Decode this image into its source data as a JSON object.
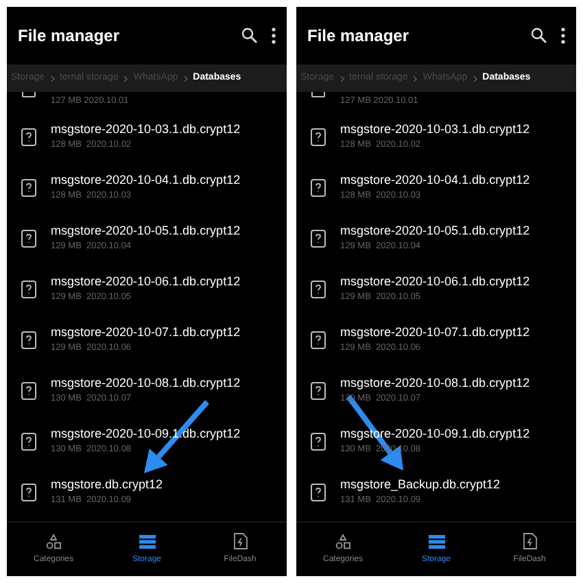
{
  "panels": [
    {
      "title": "File manager",
      "breadcrumbs": [
        {
          "label": "Storage",
          "selected": false
        },
        {
          "label": "ternal storage",
          "selected": false
        },
        {
          "label": "WhatsApp",
          "selected": false
        },
        {
          "label": "Databases",
          "selected": true
        }
      ],
      "partial_row": {
        "size": "127 MB",
        "date": "2020.10.01"
      },
      "files": [
        {
          "name": "msgstore-2020-10-03.1.db.crypt12",
          "size": "128 MB",
          "date": "2020.10.02"
        },
        {
          "name": "msgstore-2020-10-04.1.db.crypt12",
          "size": "128 MB",
          "date": "2020.10.03"
        },
        {
          "name": "msgstore-2020-10-05.1.db.crypt12",
          "size": "129 MB",
          "date": "2020.10.04"
        },
        {
          "name": "msgstore-2020-10-06.1.db.crypt12",
          "size": "129 MB",
          "date": "2020.10.05"
        },
        {
          "name": "msgstore-2020-10-07.1.db.crypt12",
          "size": "129 MB",
          "date": "2020.10.06"
        },
        {
          "name": "msgstore-2020-10-08.1.db.crypt12",
          "size": "130 MB",
          "date": "2020.10.07"
        },
        {
          "name": "msgstore-2020-10-09.1.db.crypt12",
          "size": "130 MB",
          "date": "2020.10.08"
        },
        {
          "name": "msgstore.db.crypt12",
          "size": "131 MB",
          "date": "2020.10.09"
        }
      ],
      "nav": [
        {
          "label": "Categories",
          "selected": false
        },
        {
          "label": "Storage",
          "selected": true
        },
        {
          "label": "FileDash",
          "selected": false
        }
      ]
    },
    {
      "title": "File manager",
      "breadcrumbs": [
        {
          "label": "Storage",
          "selected": false
        },
        {
          "label": "ternal storage",
          "selected": false
        },
        {
          "label": "WhatsApp",
          "selected": false
        },
        {
          "label": "Databases",
          "selected": true
        }
      ],
      "partial_row": {
        "size": "127 MB",
        "date": "2020.10.01"
      },
      "files": [
        {
          "name": "msgstore-2020-10-03.1.db.crypt12",
          "size": "128 MB",
          "date": "2020.10.02"
        },
        {
          "name": "msgstore-2020-10-04.1.db.crypt12",
          "size": "128 MB",
          "date": "2020.10.03"
        },
        {
          "name": "msgstore-2020-10-05.1.db.crypt12",
          "size": "129 MB",
          "date": "2020.10.04"
        },
        {
          "name": "msgstore-2020-10-06.1.db.crypt12",
          "size": "129 MB",
          "date": "2020.10.05"
        },
        {
          "name": "msgstore-2020-10-07.1.db.crypt12",
          "size": "129 MB",
          "date": "2020.10.06"
        },
        {
          "name": "msgstore-2020-10-08.1.db.crypt12",
          "size": "130 MB",
          "date": "2020.10.07"
        },
        {
          "name": "msgstore-2020-10-09.1.db.crypt12",
          "size": "130 MB",
          "date": "2020.10.08"
        },
        {
          "name": "msgstore_Backup.db.crypt12",
          "size": "131 MB",
          "date": "2020.10.09"
        }
      ],
      "nav": [
        {
          "label": "Categories",
          "selected": false
        },
        {
          "label": "Storage",
          "selected": true
        },
        {
          "label": "FileDash",
          "selected": false
        }
      ]
    }
  ]
}
